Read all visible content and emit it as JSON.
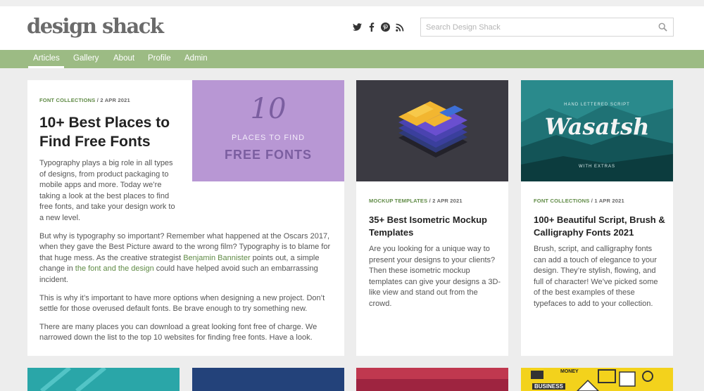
{
  "header": {
    "logo": "design shack",
    "search_placeholder": "Search Design Shack",
    "social": [
      "twitter-icon",
      "facebook-icon",
      "pinterest-icon",
      "rss-icon"
    ]
  },
  "nav": {
    "items": [
      "Articles",
      "Gallery",
      "About",
      "Profile",
      "Admin"
    ]
  },
  "featured": {
    "category": "FONT COLLECTIONS",
    "date": "/ 2 APR 2021",
    "title": "10+ Best Places to Find Free Fonts",
    "image_number": "10",
    "image_line1": "PLACES TO FIND",
    "image_line2": "FREE FONTS",
    "p1": "Typography plays a big role in all types of designs, from product packaging to mobile apps and more. Today we’re taking a look at the best places to find free fonts, and take your design work to a new level.",
    "p2_a": "But why is typography so important? Remember what happened at the Oscars 2017, when they gave the Best Picture award to the wrong film? Typography is to blame for that huge mess. As the creative strategist ",
    "p2_link1": "Benjamin Bannister",
    "p2_b": " points out, a simple change in ",
    "p2_link2": "the font and the design",
    "p2_c": " could have helped avoid such an embarrassing incident.",
    "p3": "This is why it’s important to have more options when designing a new project. Don’t settle for those overused default fonts. Be brave enough to try something new.",
    "p4": "There are many places you can download a great looking font free of charge. We narrowed down the list to the top 10 websites for finding free fonts. Have a look."
  },
  "cards": [
    {
      "category": "MOCKUP TEMPLATES",
      "date": "/ 2 APR 2021",
      "title": "35+ Best Isometric Mockup Templates",
      "body": "Are you looking for a unique way to present your designs to your clients? Then these isometric mockup templates can give your designs a 3D-like view and stand out from the crowd."
    },
    {
      "category": "FONT COLLECTIONS",
      "date": "/ 1 APR 2021",
      "title": "100+ Beautiful Script, Brush & Calligraphy Fonts 2021",
      "body": "Brush, script, and calligraphy fonts can add a touch of elegance to your design. They’re stylish, flowing, and full of character! We’ve picked some of the best examples of these typefaces to add to your collection.",
      "image_title": "Wasatsh",
      "image_top": "HAND LETTERED SCRIPT",
      "image_bottom": "WITH EXTRAS"
    }
  ],
  "bottom_thumb_text": {
    "money": "MONEY",
    "business": "BUSINESS"
  },
  "colors": {
    "nav": "#9cbb84",
    "accent": "#5f8a45",
    "featured_image": "#b897d4"
  }
}
